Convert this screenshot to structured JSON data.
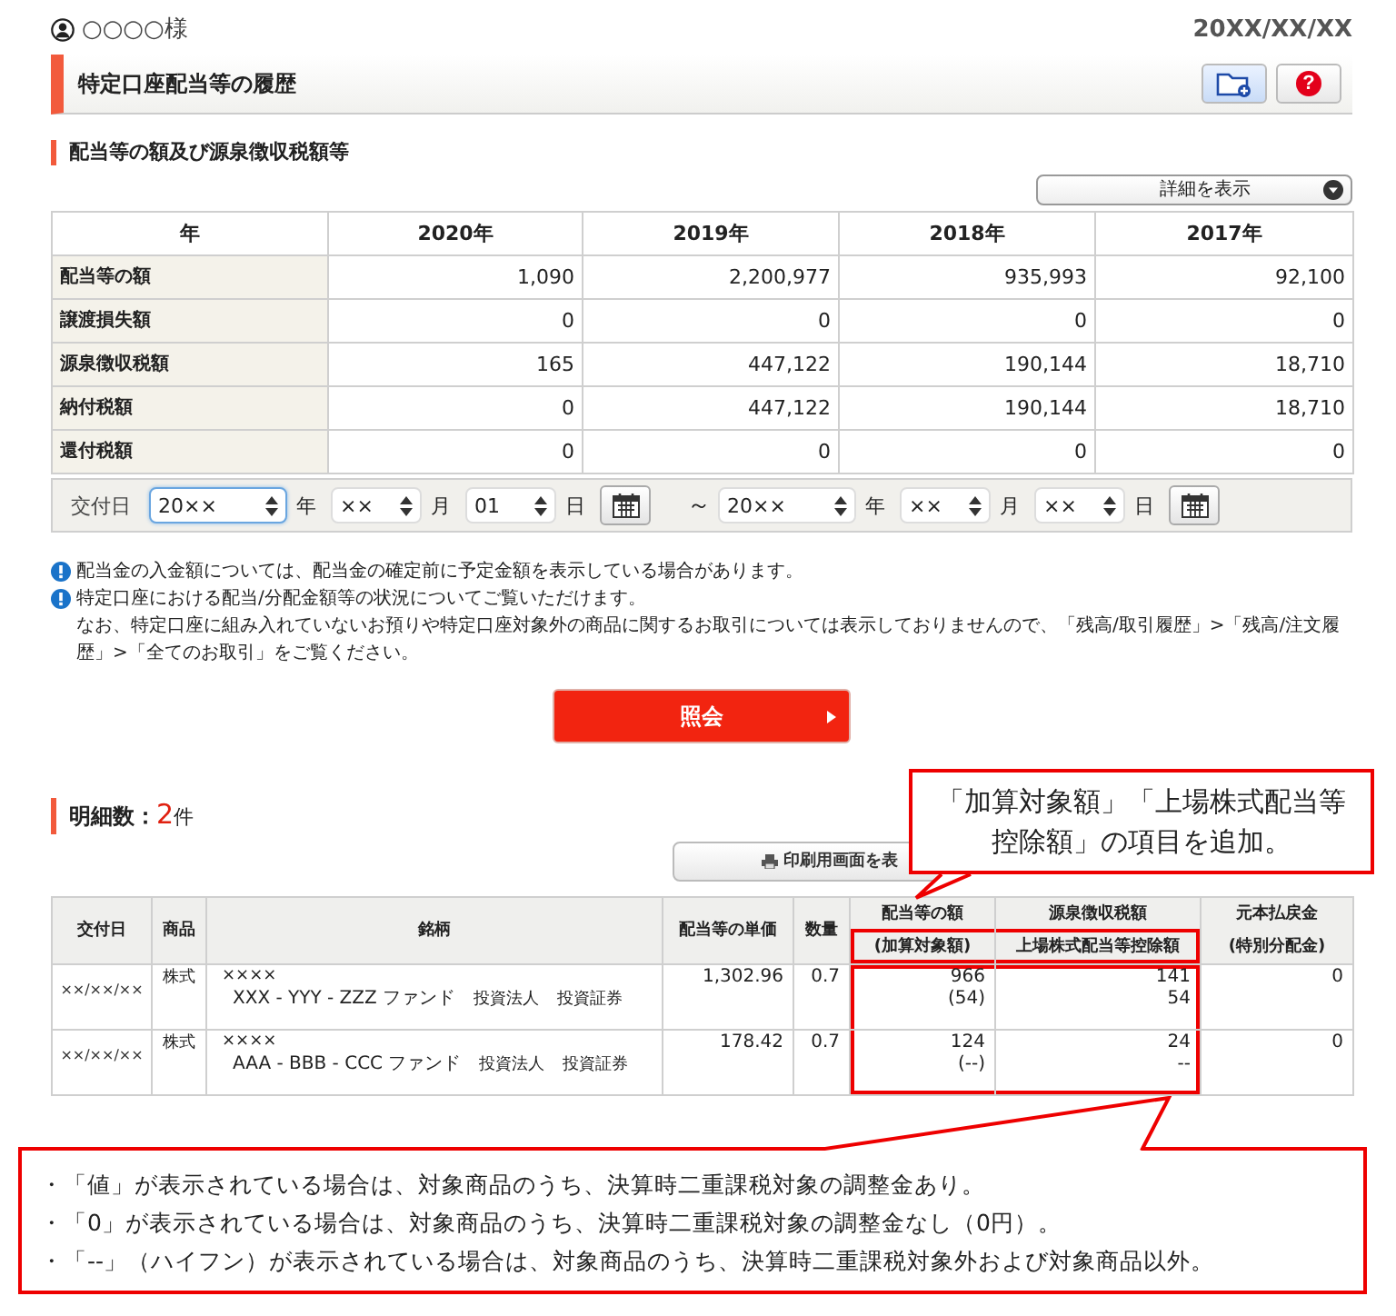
{
  "header": {
    "user_name": "○○○○様",
    "date": "20XX/XX/XX"
  },
  "page_title": "特定口座配当等の履歴",
  "help_button": "?",
  "summary": {
    "heading": "配当等の額及び源泉徴収税額等",
    "details_button": "詳細を表示",
    "columns": [
      "年",
      "2020年",
      "2019年",
      "2018年",
      "2017年"
    ],
    "rows": [
      {
        "label": "配当等の額",
        "values": [
          "1,090",
          "2,200,977",
          "935,993",
          "92,100"
        ]
      },
      {
        "label": "譲渡損失額",
        "values": [
          "0",
          "0",
          "0",
          "0"
        ]
      },
      {
        "label": "源泉徴収税額",
        "values": [
          "165",
          "447,122",
          "190,144",
          "18,710"
        ]
      },
      {
        "label": "納付税額",
        "values": [
          "0",
          "447,122",
          "190,144",
          "18,710"
        ]
      },
      {
        "label": "還付税額",
        "values": [
          "0",
          "0",
          "0",
          "0"
        ]
      }
    ]
  },
  "date_filter": {
    "label": "交付日",
    "separator": "～",
    "from": [
      {
        "value": "20××",
        "unit": "年",
        "focused": true
      },
      {
        "value": "××",
        "unit": "月",
        "focused": false
      },
      {
        "value": "01",
        "unit": "日",
        "focused": false
      }
    ],
    "to": [
      {
        "value": "20××",
        "unit": "年",
        "focused": false
      },
      {
        "value": "××",
        "unit": "月",
        "focused": false
      },
      {
        "value": "××",
        "unit": "日",
        "focused": false
      }
    ]
  },
  "notes": [
    {
      "lines": [
        "配当金の入金額については、配当金の確定前に予定金額を表示している場合があります。"
      ]
    },
    {
      "lines": [
        "特定口座における配当/分配金額等の状況についてご覧いただけます。",
        "なお、特定口座に組み入れていないお預りや特定口座対象外の商品に関するお取引については表示しておりませんので、「残高/取引履歴」>「残高/注文履歴」>「全てのお取引」をご覧ください。"
      ]
    }
  ],
  "search_button": "照会",
  "details": {
    "count_label": "明細数：",
    "count": "2",
    "count_unit": "件",
    "print_button": "印刷用画面を表",
    "columns": [
      {
        "label": "交付日",
        "highlighted": false
      },
      {
        "label": "商品",
        "highlighted": false
      },
      {
        "label": "銘柄",
        "highlighted": false
      },
      {
        "label": "配当等の単価",
        "highlighted": false
      },
      {
        "label": "数量",
        "highlighted": false
      },
      {
        "label": "配当等の額",
        "sub": "(加算対象額)",
        "highlighted": true
      },
      {
        "label": "源泉徴収税額",
        "sub": "上場株式配当等控除額",
        "highlighted": true
      },
      {
        "label": "元本払戻金",
        "sub": "(特別分配金)",
        "highlighted": false
      }
    ],
    "rows": [
      {
        "cells": [
          {
            "kind": "date",
            "text": "××/××/××"
          },
          {
            "kind": "label",
            "text": "株式"
          },
          {
            "kind": "fund",
            "mark": "××××",
            "name": "XXX - YYY - ZZZ ファンド",
            "tags": [
              "投資法人",
              "投資証券"
            ]
          },
          {
            "kind": "number",
            "text": "1,302.96"
          },
          {
            "kind": "number",
            "text": "0.7"
          },
          {
            "kind": "amount",
            "value": "966",
            "sub": "(54)"
          },
          {
            "kind": "amount",
            "value": "141",
            "sub": "54"
          },
          {
            "kind": "number",
            "text": "0"
          }
        ]
      },
      {
        "cells": [
          {
            "kind": "date",
            "text": "××/××/××"
          },
          {
            "kind": "label",
            "text": "株式"
          },
          {
            "kind": "fund",
            "mark": "××××",
            "name": "AAA - BBB - CCC ファンド",
            "tags": [
              "投資法人",
              "投資証券"
            ]
          },
          {
            "kind": "number",
            "text": "178.42"
          },
          {
            "kind": "number",
            "text": "0.7"
          },
          {
            "kind": "amount",
            "value": "124",
            "sub": "(--)"
          },
          {
            "kind": "amount",
            "value": "24",
            "sub": "--"
          },
          {
            "kind": "number",
            "text": "0"
          }
        ]
      }
    ]
  },
  "callout": "「加算対象額」「上場株式配当等控除額」の項目を追加。",
  "annotation": [
    "・「値」が表示されている場合は、対象商品のうち、決算時二重課税対象の調整金あり。",
    "・「0」が表示されている場合は、対象商品のうち、決算時二重課税対象の調整金なし（0円）。",
    "・「--」（ハイフン）が表示されている場合は、対象商品のうち、決算時二重課税対象外および対象商品以外。"
  ]
}
